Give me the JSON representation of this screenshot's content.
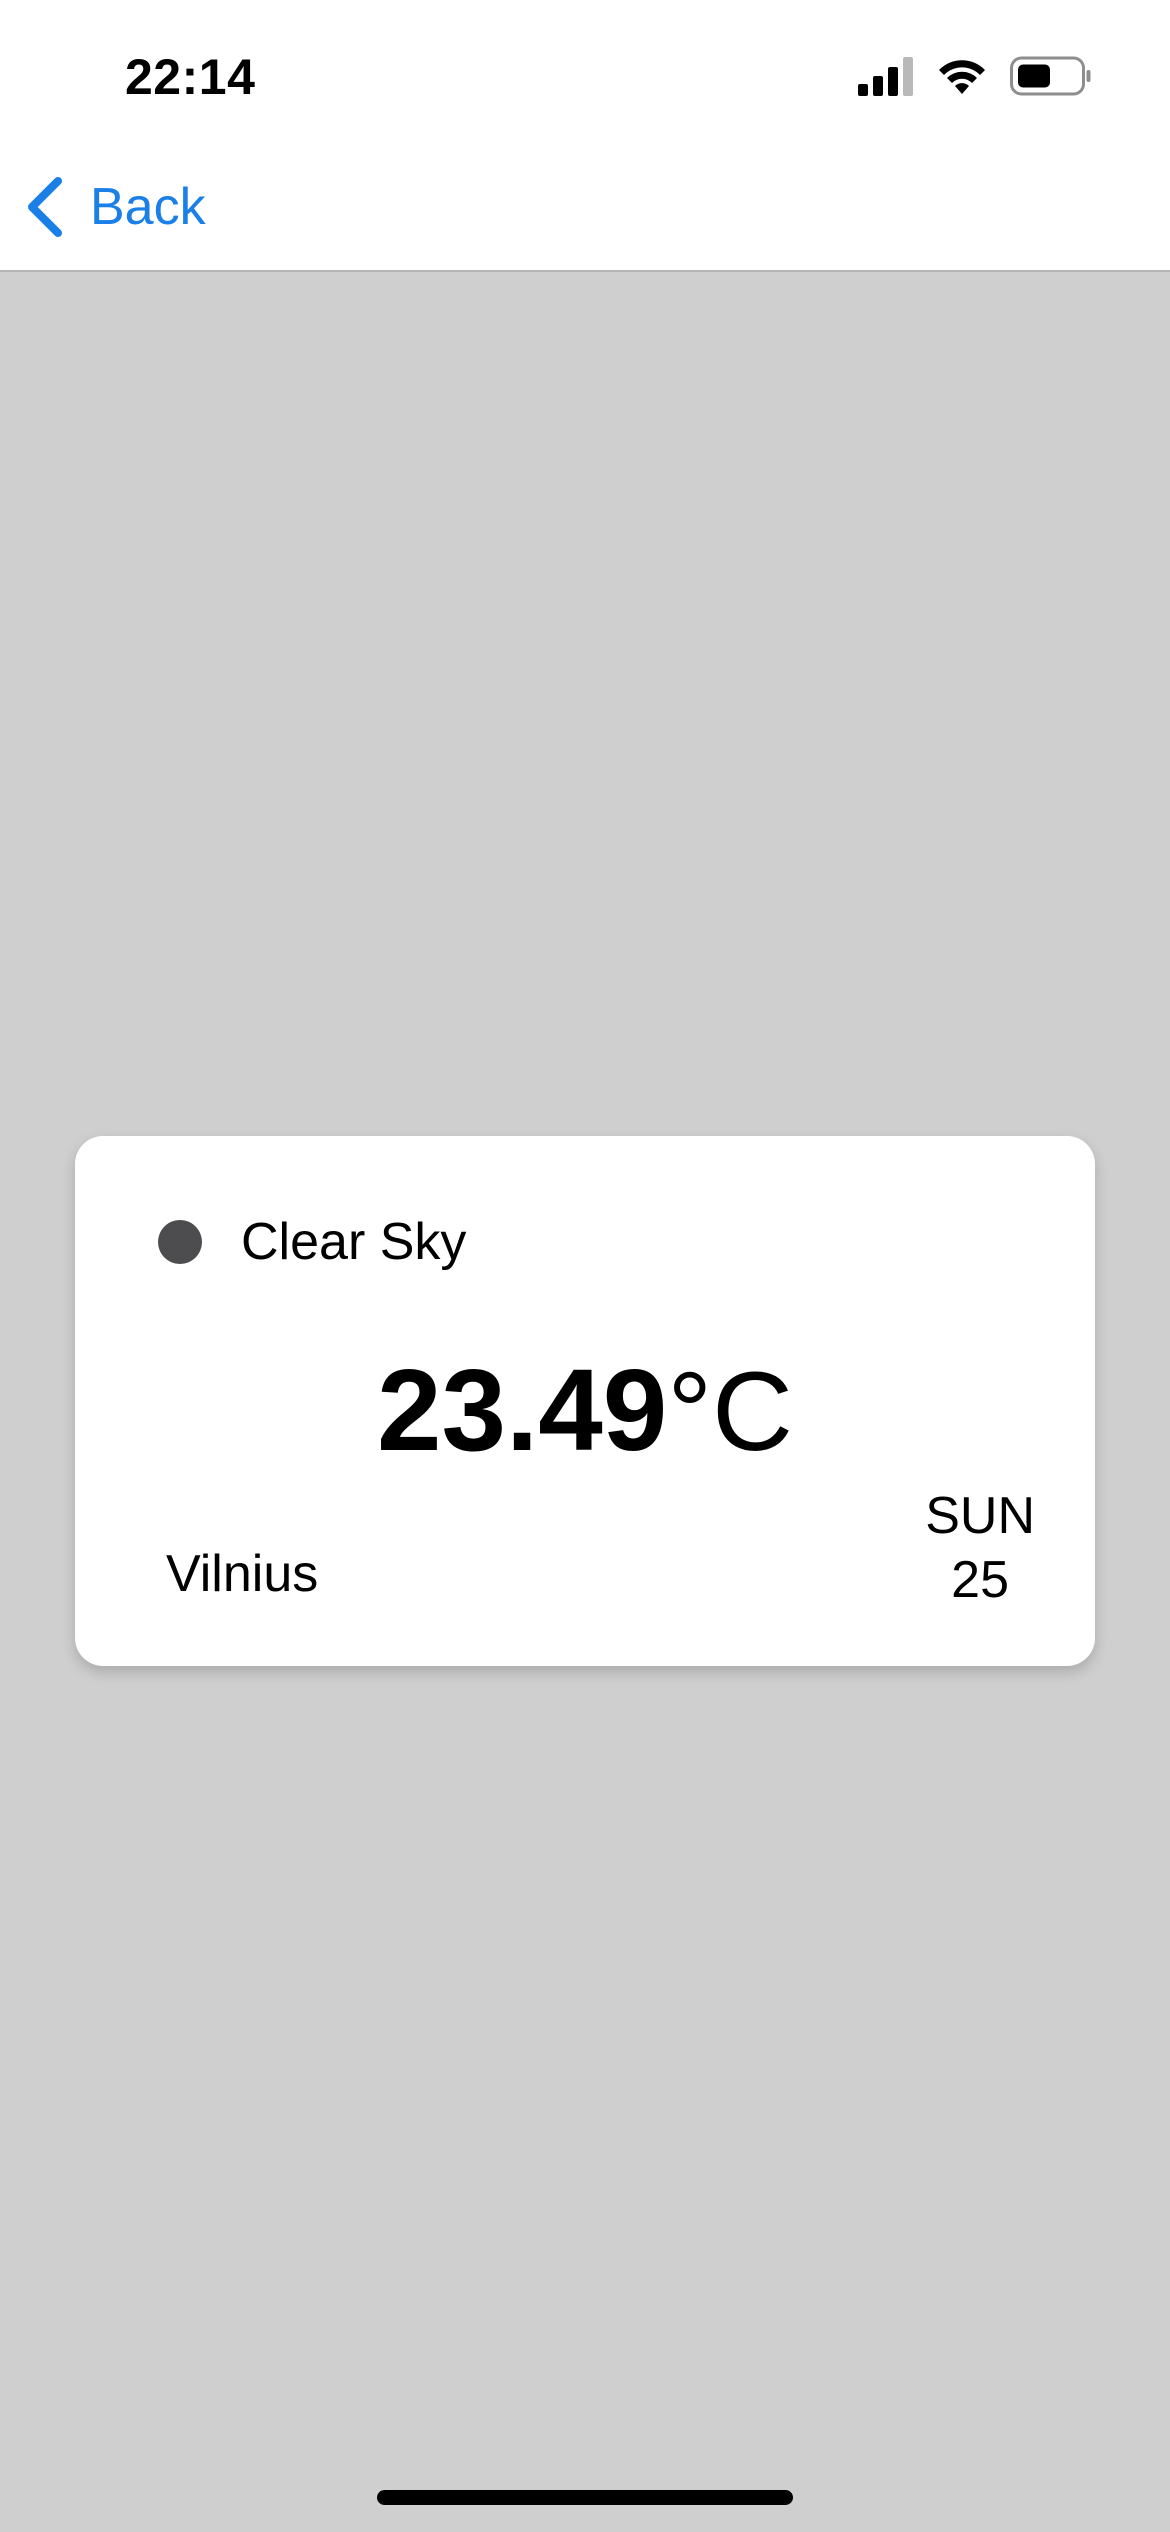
{
  "status_bar": {
    "time": "22:14",
    "icons": [
      "cellular-signal-icon",
      "wifi-icon",
      "battery-icon"
    ]
  },
  "nav": {
    "back_label": "Back",
    "accent_color": "#1a7fe6"
  },
  "weather_card": {
    "condition": "Clear Sky",
    "temperature": "23.49",
    "unit": "°C",
    "city": "Vilnius",
    "day": "SUN",
    "date": "25"
  },
  "colors": {
    "background": "#cfcfcf",
    "card": "#ffffff",
    "dot": "#4d4d4f"
  }
}
